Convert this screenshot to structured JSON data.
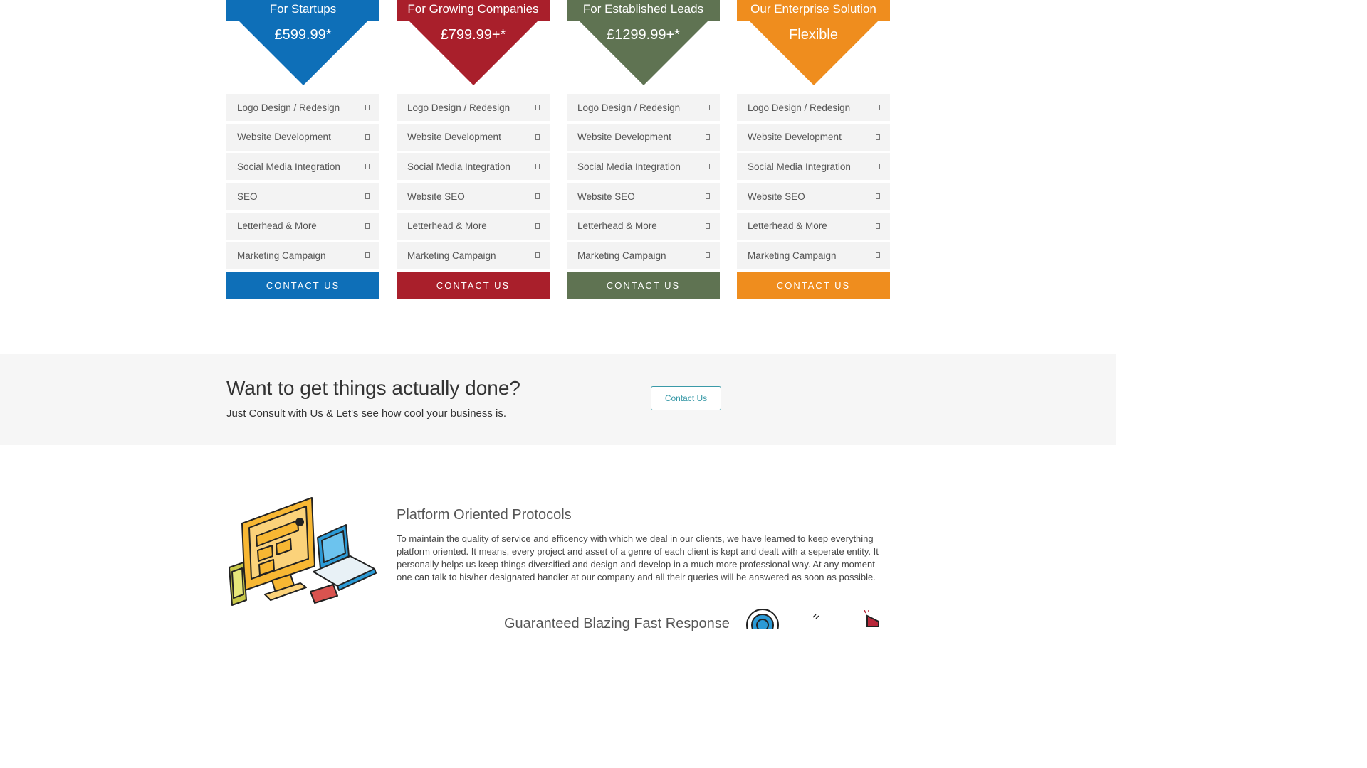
{
  "plans": [
    {
      "name": "For Startups",
      "price": "£599.99*",
      "color": "#0e6fb8",
      "features": [
        "Logo Design / Redesign",
        "Website Development",
        "Social Media Integration",
        "SEO",
        "Letterhead & More",
        "Marketing Campaign"
      ],
      "button": "CONTACT US"
    },
    {
      "name": "For Growing Companies",
      "price": "£799.99+*",
      "color": "#a91f2b",
      "features": [
        "Logo Design / Redesign",
        "Website Development",
        "Social Media Integration",
        "Website SEO",
        "Letterhead & More",
        "Marketing Campaign"
      ],
      "button": "CONTACT US"
    },
    {
      "name": "For Established Leads",
      "price": "£1299.99+*",
      "color": "#5f7352",
      "features": [
        "Logo Design / Redesign",
        "Website Development",
        "Social Media Integration",
        "Website SEO",
        "Letterhead & More",
        "Marketing Campaign"
      ],
      "button": "CONTACT US"
    },
    {
      "name": "Our Enterprise Solution",
      "price": "Flexible",
      "color": "#ef8d1e",
      "features": [
        "Logo Design / Redesign",
        "Website Development",
        "Social Media Integration",
        "Website SEO",
        "Letterhead & More",
        "Marketing Campaign"
      ],
      "button": "CONTACT US"
    }
  ],
  "feature_icon": "check-box-icon",
  "cta": {
    "title": "Want to get things actually done?",
    "subtitle": "Just Consult with Us & Let's see how cool your business is.",
    "button": "Contact Us",
    "accent": "#3a9aa8"
  },
  "feature": {
    "illustration": "devices-illustration",
    "title": "Platform Oriented Protocols",
    "body": "To maintain the quality of service and efficency with which we deal in our clients, we have learned to keep everything platform oriented. It means, every project and asset of a genre of each client is kept and dealt with a seperate entity. It personally helps us keep things diversified and design and develop in a much more professional way. At any moment one can talk to his/her designated handler at our company and all their queries will be answered as soon as possible."
  },
  "feature2": {
    "title": "Guaranteed Blazing Fast Response"
  }
}
